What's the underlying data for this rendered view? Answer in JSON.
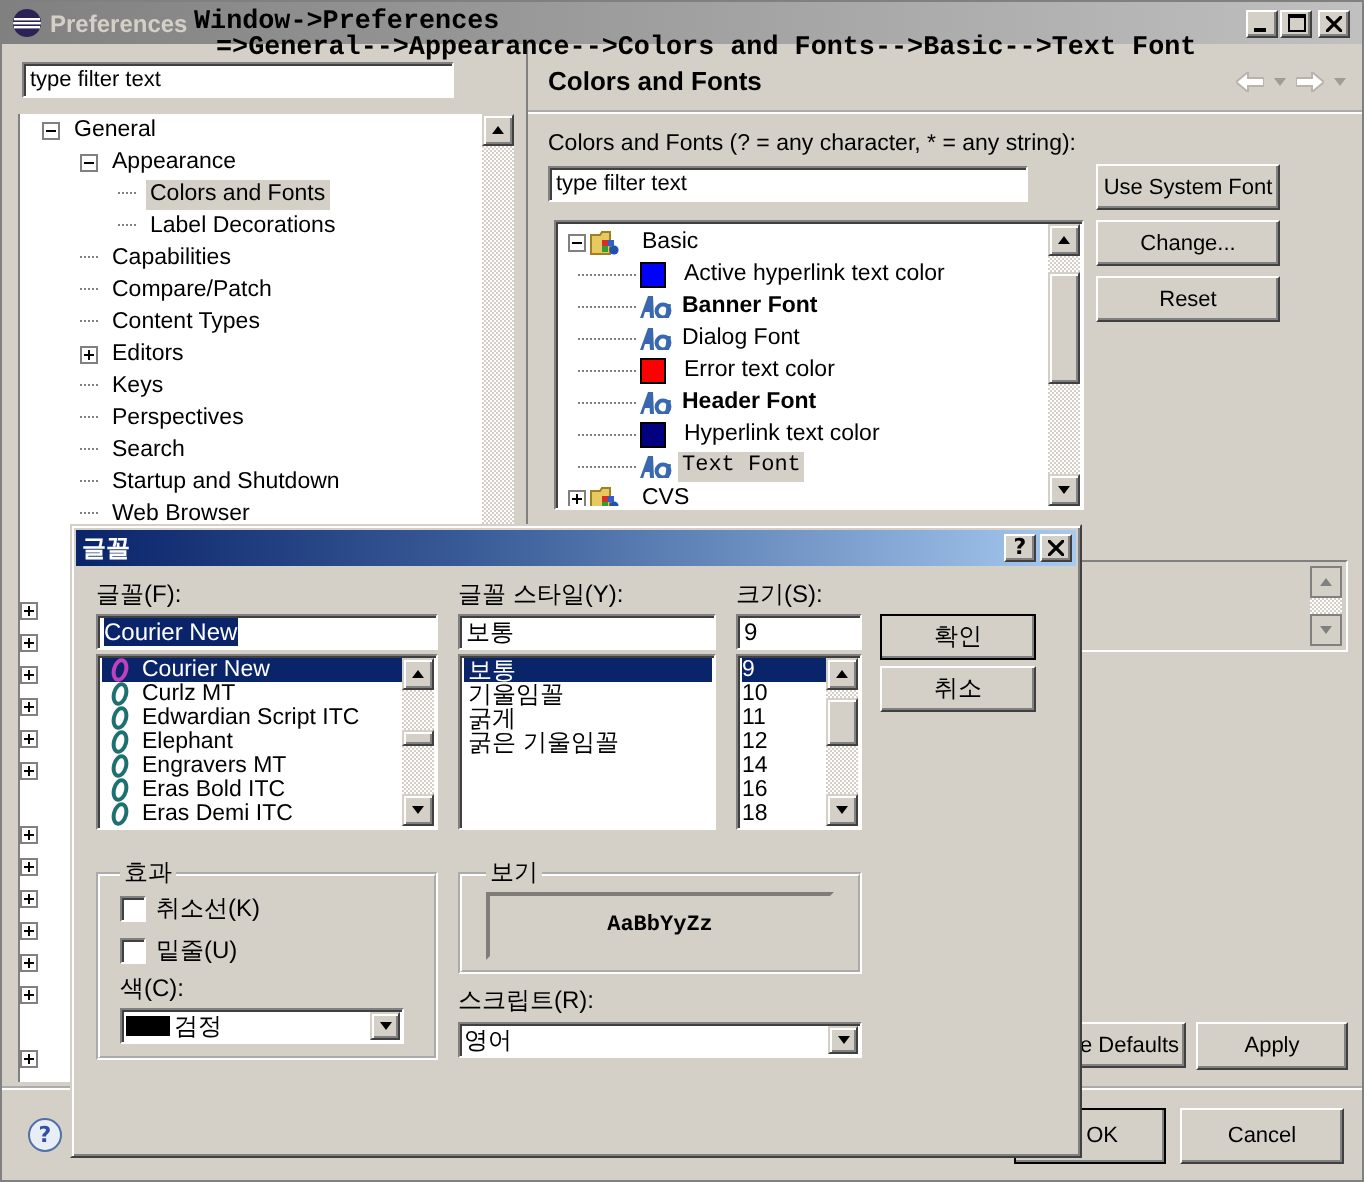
{
  "window": {
    "title": "Preferences"
  },
  "annotation": [
    "Window->Preferences",
    "=>General-->Appearance-->Colors and Fonts-->Basic-->Text Font"
  ],
  "sidebar": {
    "filter": {
      "placeholder": "type filter text"
    },
    "tree": [
      {
        "label": "General",
        "expanded": true,
        "selected": false,
        "children": [
          {
            "label": "Appearance",
            "expanded": true,
            "selected": false,
            "children": [
              {
                "label": "Colors and Fonts",
                "selected": true
              },
              {
                "label": "Label Decorations",
                "selected": false
              }
            ]
          },
          {
            "label": "Capabilities",
            "selected": false
          },
          {
            "label": "Compare/Patch",
            "selected": false
          },
          {
            "label": "Content Types",
            "selected": false
          },
          {
            "label": "Editors",
            "expanded": false,
            "selected": false
          },
          {
            "label": "Keys",
            "selected": false
          },
          {
            "label": "Perspectives",
            "selected": false
          },
          {
            "label": "Search",
            "selected": false
          },
          {
            "label": "Startup and Shutdown",
            "selected": false
          },
          {
            "label": "Web Browser",
            "selected": false
          }
        ]
      }
    ]
  },
  "page": {
    "title": "Colors and Fonts",
    "label": "Colors and Fonts (? = any character, * = any string):",
    "filter": {
      "placeholder": "type filter text"
    },
    "tree": [
      {
        "label": "Basic",
        "kind": "folder",
        "expanded": true,
        "selected": false,
        "children": [
          {
            "label": "Active hyperlink text color",
            "kind": "color",
            "color": "#0000ff",
            "selected": false
          },
          {
            "label": "Banner Font",
            "kind": "boldfont",
            "selected": false
          },
          {
            "label": "Dialog Font",
            "kind": "font",
            "selected": false
          },
          {
            "label": "Error text color",
            "kind": "color",
            "color": "#ff0000",
            "selected": false
          },
          {
            "label": "Header Font",
            "kind": "boldfont",
            "selected": false
          },
          {
            "label": "Hyperlink text color",
            "kind": "color",
            "color": "#000080",
            "selected": false
          },
          {
            "label": "Text Font",
            "kind": "monofont",
            "selected": true
          }
        ]
      },
      {
        "label": "CVS",
        "kind": "folder",
        "expanded": false,
        "selected": false
      }
    ],
    "buttons": [
      "Use System Font",
      "Change...",
      "Reset"
    ],
    "footer_buttons": [
      "e Defaults",
      "Apply"
    ]
  },
  "dialog_buttons": [
    "OK",
    "Cancel"
  ],
  "help": "?",
  "font_dialog": {
    "title": "글꼴",
    "help": "?",
    "font": {
      "label": "글꼴(F):",
      "value": "Courier New",
      "options": [
        {
          "name": "Courier New",
          "selected": true
        },
        {
          "name": "Curlz MT",
          "selected": false
        },
        {
          "name": "Edwardian Script ITC",
          "selected": false
        },
        {
          "name": "Elephant",
          "selected": false
        },
        {
          "name": "Engravers MT",
          "selected": false
        },
        {
          "name": "Eras Bold ITC",
          "selected": false
        },
        {
          "name": "Eras Demi ITC",
          "selected": false
        }
      ]
    },
    "style": {
      "label": "글꼴 스타일(Y):",
      "value": "보통",
      "options": [
        {
          "name": "보통",
          "selected": true
        },
        {
          "name": "기울임꼴",
          "selected": false
        },
        {
          "name": "굵게",
          "selected": false
        },
        {
          "name": "굵은 기울임꼴",
          "selected": false
        }
      ]
    },
    "size": {
      "label": "크기(S):",
      "value": "9",
      "options": [
        {
          "name": "9",
          "selected": true
        },
        {
          "name": "10",
          "selected": false
        },
        {
          "name": "11",
          "selected": false
        },
        {
          "name": "12",
          "selected": false
        },
        {
          "name": "14",
          "selected": false
        },
        {
          "name": "16",
          "selected": false
        },
        {
          "name": "18",
          "selected": false
        }
      ]
    },
    "buttons": [
      {
        "label": "확인",
        "default": true
      },
      {
        "label": "취소",
        "default": false
      }
    ],
    "effects": {
      "title": "효과",
      "checkboxes": [
        {
          "label": "취소선(K)",
          "checked": false
        },
        {
          "label": "밑줄(U)",
          "checked": false
        }
      ],
      "color_label": "색(C):",
      "color": {
        "value": "검정",
        "color": "#000000"
      }
    },
    "preview": {
      "title": "보기",
      "sample": "AaBbYyZz"
    },
    "script": {
      "label": "스크립트(R):",
      "value": "영어"
    }
  }
}
